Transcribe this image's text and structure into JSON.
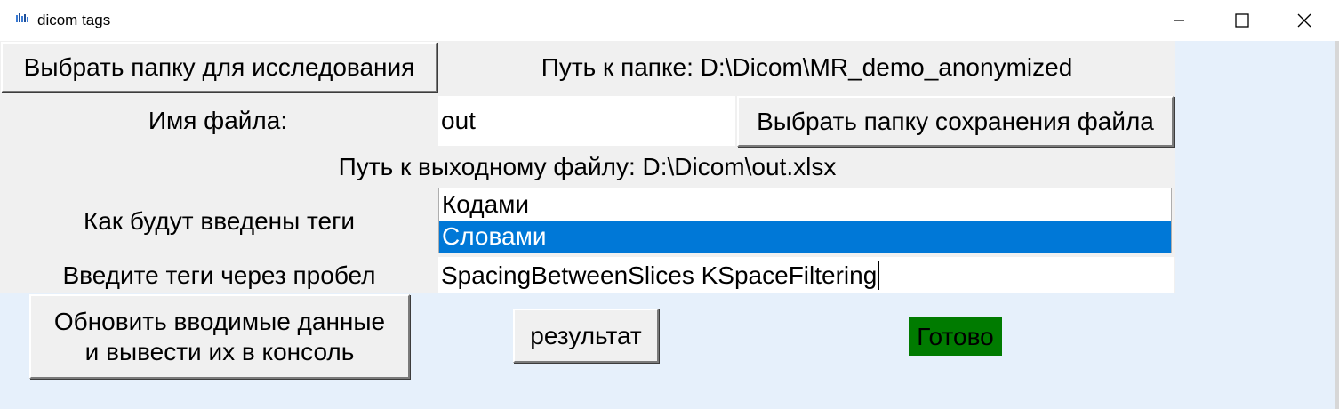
{
  "window": {
    "title": "dicom tags",
    "minimize_icon": "minimize-icon",
    "maximize_icon": "maximize-icon",
    "close_icon": "close-icon"
  },
  "study": {
    "choose_folder_button": "Выбрать папку для исследования",
    "folder_path_label": "Путь к папке: D:\\Dicom\\MR_demo_anonymized"
  },
  "output": {
    "file_name_label": "Имя файла:",
    "file_name_value": "out",
    "choose_save_folder_button": "Выбрать папку сохранения файла",
    "output_path_label": "Путь к выходному файлу: D:\\Dicom\\out.xlsx"
  },
  "tags": {
    "mode_label": "Как будут введены теги",
    "mode_options": [
      "Кодами",
      "Словами"
    ],
    "selected_option": "Словами",
    "input_label": "Введите теги через пробел",
    "input_value": "SpacingBetweenSlices KSpaceFiltering"
  },
  "actions": {
    "update_button_line1": "Обновить вводимые данные",
    "update_button_line2": "и вывести их в консоль",
    "result_button": "результат",
    "status_text": "Готово"
  },
  "colors": {
    "selection": "#0078d7",
    "status_bg": "#007b00",
    "window_bg": "#e6f0fb",
    "widget_bg": "#f0f0f0"
  }
}
